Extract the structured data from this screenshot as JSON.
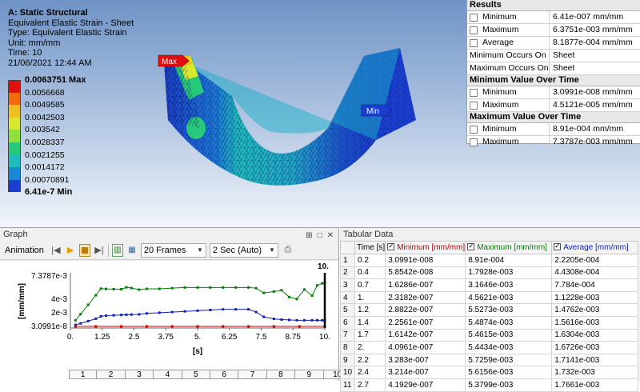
{
  "viewport": {
    "title": "A: Static Structural",
    "lines": [
      "Equivalent Elastic Strain - Sheet",
      "Type: Equivalent Elastic Strain",
      "Unit: mm/mm",
      "Time: 10",
      "21/06/2021 12:44 AM"
    ],
    "legend": [
      {
        "label": "0.0063751 Max",
        "color": "#e01010",
        "bold": true
      },
      {
        "label": "0.0056668",
        "color": "#f26a10",
        "bold": false
      },
      {
        "label": "0.0049585",
        "color": "#f0c020",
        "bold": false
      },
      {
        "label": "0.0042503",
        "color": "#d8e82a",
        "bold": false
      },
      {
        "label": "0.003542",
        "color": "#8ee03a",
        "bold": false
      },
      {
        "label": "0.0028337",
        "color": "#28c87a",
        "bold": false
      },
      {
        "label": "0.0021255",
        "color": "#1ebdbd",
        "bold": false
      },
      {
        "label": "0.0014172",
        "color": "#1a88d8",
        "bold": false
      },
      {
        "label": "0.00070891",
        "color": "#1a3ed0",
        "bold": false
      },
      {
        "label": "6.41e-7 Min",
        "color": null,
        "bold": true
      }
    ],
    "max_tag": "Max",
    "min_tag": "Min"
  },
  "results": {
    "sections": [
      {
        "title": "Results",
        "rows": [
          {
            "label": "Minimum",
            "value": "6.41e-007 mm/mm",
            "checkbox": true
          },
          {
            "label": "Maximum",
            "value": "6.3751e-003 mm/mm",
            "checkbox": true
          },
          {
            "label": "Average",
            "value": "8.1877e-004 mm/mm",
            "checkbox": true
          },
          {
            "label": "Minimum Occurs On",
            "value": "Sheet",
            "checkbox": false
          },
          {
            "label": "Maximum Occurs On",
            "value": "Sheet",
            "checkbox": false
          }
        ]
      },
      {
        "title": "Minimum Value Over Time",
        "rows": [
          {
            "label": "Minimum",
            "value": "3.0991e-008 mm/mm",
            "checkbox": true
          },
          {
            "label": "Maximum",
            "value": "4.5121e-005 mm/mm",
            "checkbox": true
          }
        ]
      },
      {
        "title": "Maximum Value Over Time",
        "rows": [
          {
            "label": "Minimum",
            "value": "8.91e-004 mm/mm",
            "checkbox": true
          },
          {
            "label": "Maximum",
            "value": "7.3787e-003 mm/mm",
            "checkbox": true
          }
        ]
      }
    ]
  },
  "graph": {
    "title": "Graph",
    "animation_label": "Animation",
    "frames": "20 Frames",
    "duration": "2 Sec (Auto)",
    "frame_cells": [
      "1",
      "2",
      "3",
      "4",
      "5",
      "6",
      "7",
      "8",
      "9",
      "10"
    ]
  },
  "chart_data": {
    "type": "line",
    "ylabel": "[mm/mm]",
    "xlabel": "[s]",
    "y_ticks": [
      "7.3787e-3",
      "4e-3",
      "2e-3",
      "3.0991e-8"
    ],
    "y_tick_values": [
      0.0073787,
      0.004,
      0.002,
      3.0991e-08
    ],
    "x_ticks": [
      "0.",
      "1.25",
      "2.5",
      "3.75",
      "5.",
      "6.25",
      "7.5",
      "8.75",
      "10."
    ],
    "x_tick_values": [
      0,
      1.25,
      2.5,
      3.75,
      5,
      6.25,
      7.5,
      8.75,
      10
    ],
    "xlim": [
      0,
      10
    ],
    "ylim": [
      3.0991e-08,
      0.0073787
    ],
    "current_time_label": "10.",
    "current_time": 10,
    "series": [
      {
        "color": "#008000",
        "x": [
          0.2,
          0.4,
          0.7,
          1,
          1.2,
          1.4,
          1.7,
          2,
          2.2,
          2.4,
          2.7,
          3,
          3.5,
          4,
          4.5,
          5,
          5.5,
          6,
          6.5,
          7,
          7.3,
          7.6,
          8,
          8.3,
          8.6,
          8.9,
          9.2,
          9.5,
          9.7,
          9.9,
          10
        ],
        "y": [
          0.000891,
          0.0017928,
          0.0031646,
          0.0045621,
          0.0055273,
          0.0054874,
          0.0054615,
          0.0054434,
          0.0057259,
          0.0056156,
          0.0053799,
          0.0055,
          0.0055,
          0.0056,
          0.0057,
          0.0057,
          0.0057,
          0.0057,
          0.0057,
          0.0057,
          0.0056,
          0.0049,
          0.0051,
          0.0053,
          0.0043,
          0.004,
          0.0054,
          0.0045,
          0.006,
          0.0063,
          0.0063751
        ]
      },
      {
        "color": "#1020c0",
        "x": [
          0.2,
          0.4,
          0.7,
          1,
          1.2,
          1.4,
          1.7,
          2,
          2.2,
          2.4,
          2.7,
          3,
          3.5,
          4,
          4.5,
          5,
          5.5,
          6,
          6.5,
          7,
          7.3,
          7.6,
          8,
          8.3,
          8.6,
          8.9,
          9.2,
          9.5,
          9.7,
          9.9,
          10
        ],
        "y": [
          0.00022205,
          0.00044308,
          0.0007784,
          0.0011228,
          0.0014762,
          0.0015616,
          0.0016304,
          0.0016726,
          0.0017141,
          0.001732,
          0.0017661,
          0.0019,
          0.002,
          0.0021,
          0.0022,
          0.0023,
          0.0024,
          0.0025,
          0.0025,
          0.0025,
          0.0021,
          0.0014,
          0.0011,
          0.001,
          0.00095,
          0.0009,
          0.0009,
          0.0009,
          0.0009,
          0.0009,
          0.00081877
        ]
      },
      {
        "color": "#c80000",
        "x": [
          0.2,
          1,
          2,
          3,
          4,
          5,
          6,
          7,
          8,
          9,
          10
        ],
        "y": [
          3.0991e-08,
          2.3e-07,
          4.1e-07,
          4e-07,
          4e-07,
          4e-07,
          4e-07,
          4e-07,
          4e-07,
          4e-07,
          6.41e-07
        ]
      }
    ]
  },
  "tabular": {
    "title": "Tabular Data",
    "columns": [
      "Time [s]",
      "Minimum [mm/mm]",
      "Maximum [mm/mm]",
      "Average [mm/mm]"
    ],
    "rows": [
      [
        "1",
        "0.2",
        "3.0991e-008",
        "8.91e-004",
        "2.2205e-004"
      ],
      [
        "2",
        "0.4",
        "5.8542e-008",
        "1.7928e-003",
        "4.4308e-004"
      ],
      [
        "3",
        "0.7",
        "1.6286e-007",
        "3.1646e-003",
        "7.784e-004"
      ],
      [
        "4",
        "1.",
        "2.3182e-007",
        "4.5621e-003",
        "1.1228e-003"
      ],
      [
        "5",
        "1.2",
        "2.8822e-007",
        "5.5273e-003",
        "1.4762e-003"
      ],
      [
        "6",
        "1.4",
        "2.2561e-007",
        "5.4874e-003",
        "1.5616e-003"
      ],
      [
        "7",
        "1.7",
        "1.6142e-007",
        "5.4615e-003",
        "1.6304e-003"
      ],
      [
        "8",
        "2.",
        "4.0961e-007",
        "5.4434e-003",
        "1.6726e-003"
      ],
      [
        "9",
        "2.2",
        "3.283e-007",
        "5.7259e-003",
        "1.7141e-003"
      ],
      [
        "10",
        "2.4",
        "3.214e-007",
        "5.6156e-003",
        "1.732e-003"
      ],
      [
        "11",
        "2.7",
        "4.1929e-007",
        "5.3799e-003",
        "1.7661e-003"
      ]
    ]
  }
}
